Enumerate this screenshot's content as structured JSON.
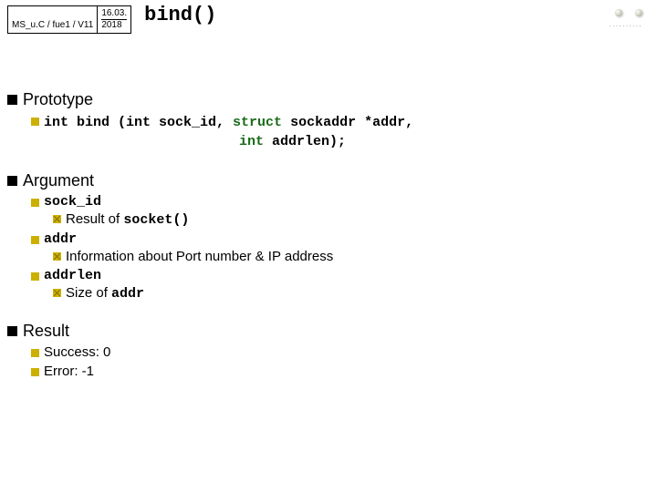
{
  "meta": {
    "course": "MS_u.C / fue1 / V11",
    "date_top": "16.03.",
    "date_bot": "2018"
  },
  "title": "bind()",
  "sections": {
    "prototype": {
      "heading": "Prototype",
      "line1_pre": "int bind (int sock_id, ",
      "line1_kw1": "struct",
      "line1_mid": " sockaddr *addr,",
      "line2_pre": "int",
      "line2_post": " addrlen);"
    },
    "argument": {
      "heading": "Argument",
      "a1_name": "sock_id",
      "a1_desc_pre": "Result of ",
      "a1_desc_code": "socket()",
      "a2_name": "addr",
      "a2_desc": "Information about Port number & IP address",
      "a3_name": "addrlen",
      "a3_desc_pre": "Size of ",
      "a3_desc_code": "addr"
    },
    "result": {
      "heading": "Result",
      "r1": "Success: 0",
      "r2": "Error: -1"
    }
  }
}
